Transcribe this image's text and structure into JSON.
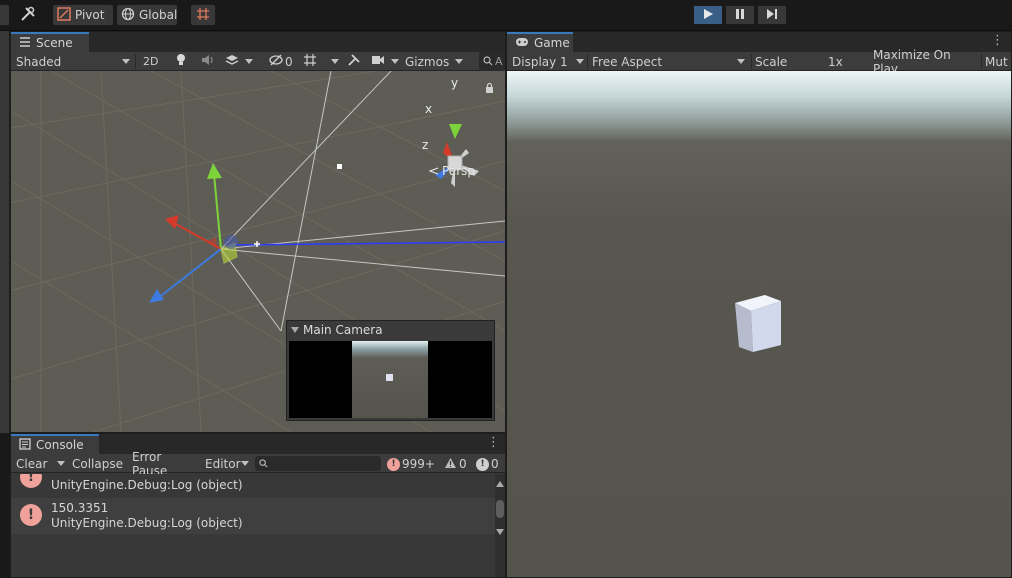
{
  "toolbar": {
    "pivot_label": "Pivot",
    "global_label": "Global"
  },
  "scene": {
    "tab_label": "Scene",
    "shading_mode": "Shaded",
    "two_d_label": "2D",
    "hidden_count": "0",
    "gizmos_label": "Gizmos",
    "search_placeholder": "A",
    "axis_x": "x",
    "axis_y": "y",
    "axis_z": "z",
    "projection_label": "Persp",
    "camera_preview_title": "Main Camera"
  },
  "game": {
    "tab_label": "Game",
    "display_label": "Display 1",
    "aspect_label": "Free Aspect",
    "scale_label": "Scale",
    "scale_value": "1x",
    "maximize_label": "Maximize On Play",
    "mute_label": "Mut"
  },
  "console": {
    "tab_label": "Console",
    "clear_label": "Clear",
    "collapse_label": "Collapse",
    "error_pause_label": "Error Pause",
    "editor_label": "Editor",
    "search_placeholder": "",
    "log_count": "999+",
    "warning_count": "0",
    "error_count": "0",
    "rows": [
      {
        "line1": "",
        "line2": "UnityEngine.Debug:Log (object)"
      },
      {
        "line1": "150.3351",
        "line2": "UnityEngine.Debug:Log (object)"
      }
    ]
  },
  "colors": {
    "accent": "#3a79bb",
    "play_active": "#3a5f86",
    "log_icon": "#f0a29a"
  }
}
